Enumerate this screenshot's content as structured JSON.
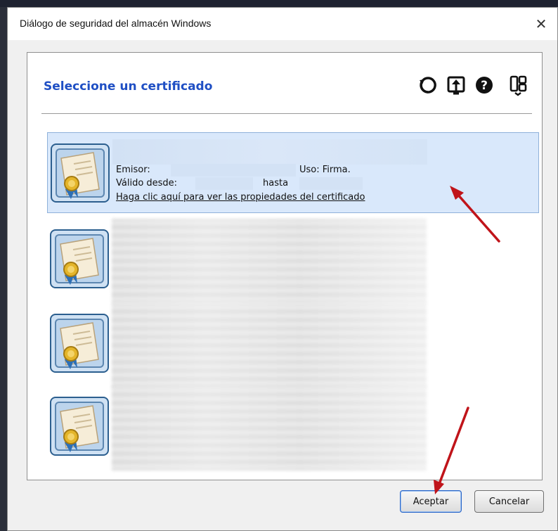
{
  "window": {
    "title": "Diálogo de seguridad del almacén Windows",
    "close_glyph": "✕"
  },
  "panel": {
    "heading": "Seleccione un certificado",
    "toolbar": [
      {
        "icon": "refresh-icon"
      },
      {
        "icon": "import-icon"
      },
      {
        "icon": "help-icon"
      },
      {
        "icon": "view-icon"
      }
    ]
  },
  "certificates": [
    {
      "selected": true,
      "issuer_label": "Emisor:",
      "usage_label": "Uso: Firma.",
      "valid_from_label": "Válido desde:",
      "valid_to_label": "hasta",
      "properties_link": "Haga clic aquí para ver las propiedades del certificado"
    },
    {
      "selected": false
    },
    {
      "selected": false
    },
    {
      "selected": false
    }
  ],
  "buttons": {
    "accept": "Aceptar",
    "cancel": "Cancelar"
  },
  "colors": {
    "heading": "#1f4fc4",
    "selection": "#d9e8fb",
    "annotation_arrow": "#c0141a"
  }
}
